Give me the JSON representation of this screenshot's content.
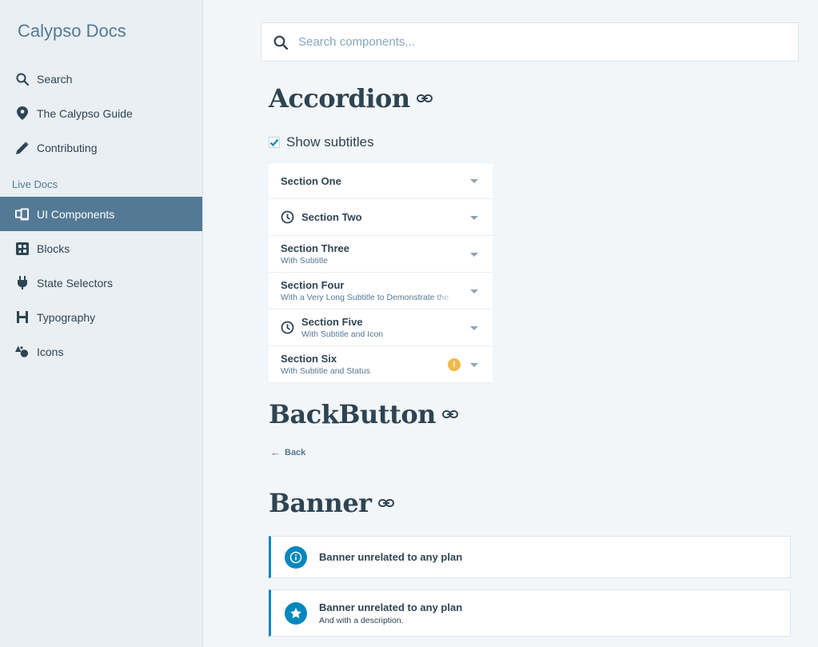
{
  "sidebar": {
    "brand": "Calypso Docs",
    "items": [
      {
        "label": "Search",
        "icon": "search-icon"
      },
      {
        "label": "The Calypso Guide",
        "icon": "location-pin-icon"
      },
      {
        "label": "Contributing",
        "icon": "pencil-icon"
      }
    ],
    "section_label": "Live Docs",
    "live_items": [
      {
        "label": "UI Components",
        "icon": "devices-icon",
        "active": true
      },
      {
        "label": "Blocks",
        "icon": "blocks-icon"
      },
      {
        "label": "State Selectors",
        "icon": "plug-icon"
      },
      {
        "label": "Typography",
        "icon": "heading-icon"
      },
      {
        "label": "Icons",
        "icon": "shapes-icon"
      }
    ]
  },
  "search": {
    "placeholder": "Search components..."
  },
  "accordion": {
    "heading": "Accordion",
    "show_subtitles_label": "Show subtitles",
    "show_subtitles_checked": true,
    "items": [
      {
        "title": "Section One",
        "subtitle": ""
      },
      {
        "title": "Section Two",
        "subtitle": "",
        "icon": "clock-icon"
      },
      {
        "title": "Section Three",
        "subtitle": "With Subtitle"
      },
      {
        "title": "Section Four",
        "subtitle": "With a Very Long Subtitle to Demonstrate the"
      },
      {
        "title": "Section Five",
        "subtitle": "With Subtitle and Icon",
        "icon": "clock-icon"
      },
      {
        "title": "Section Six",
        "subtitle": "With Subtitle and Status",
        "status": "!"
      }
    ]
  },
  "back_button": {
    "heading": "BackButton",
    "label": "Back"
  },
  "banner": {
    "heading": "Banner",
    "items": [
      {
        "title": "Banner unrelated to any plan",
        "description": "",
        "icon": "info-icon"
      },
      {
        "title": "Banner unrelated to any plan",
        "description": "And with a description.",
        "icon": "star-icon"
      }
    ]
  },
  "colors": {
    "accent": "#537994",
    "banner_blue": "#0087be",
    "warning": "#f0b849",
    "text": "#2e4453"
  }
}
